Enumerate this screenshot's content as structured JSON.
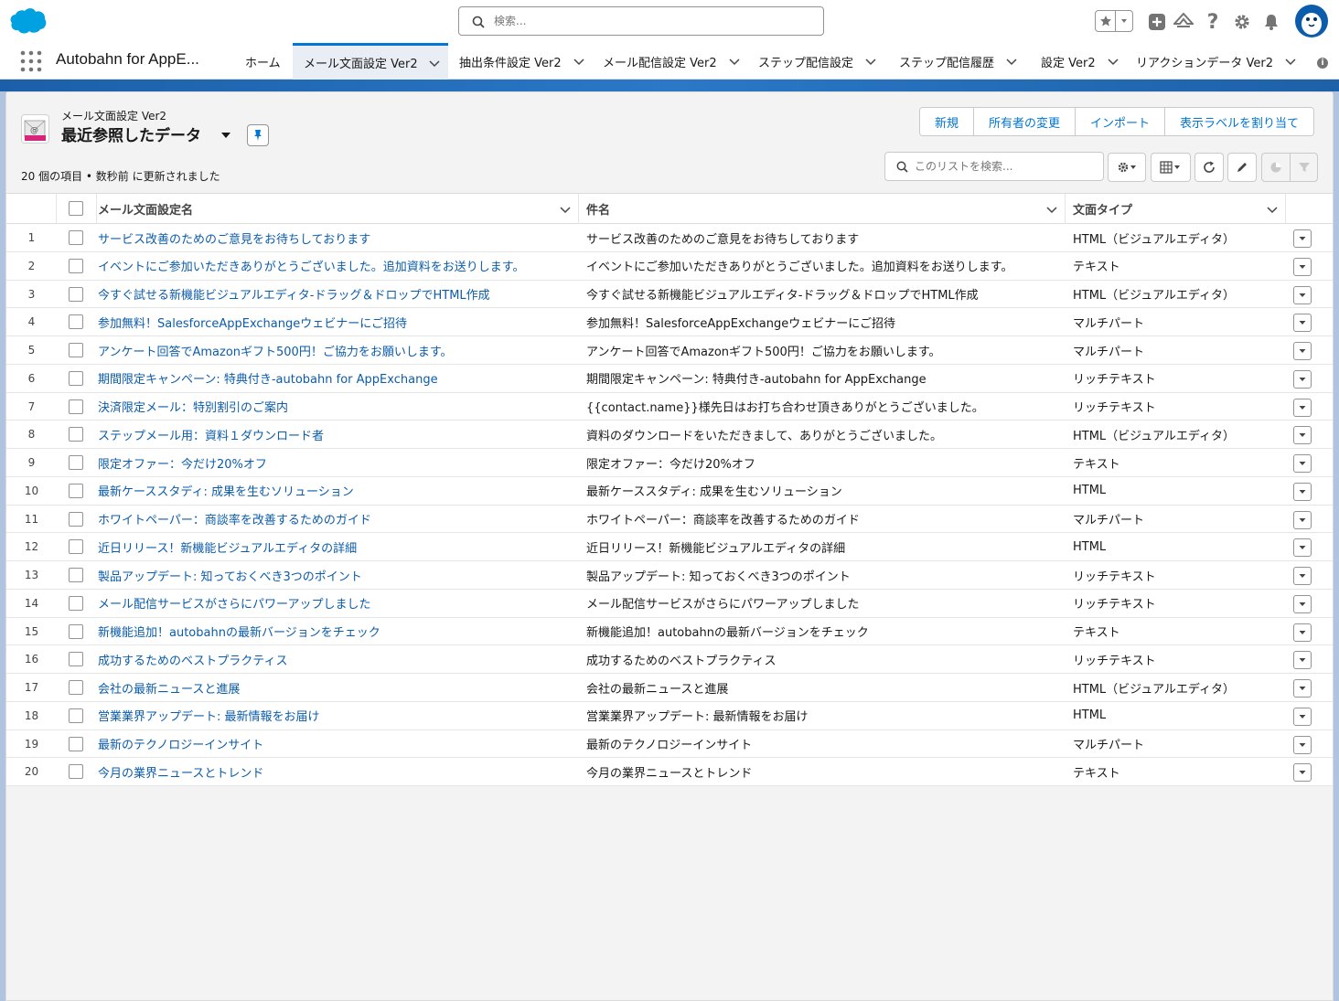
{
  "header": {
    "search_placeholder": "検索..."
  },
  "nav": {
    "app_name": "Autobahn for AppE...",
    "tabs": [
      {
        "label": "ホーム"
      },
      {
        "label": "メール文面設定 Ver2"
      },
      {
        "label": "抽出条件設定 Ver2"
      },
      {
        "label": "メール配信設定 Ver2"
      },
      {
        "label": "ステップ配信設定"
      },
      {
        "label": "ステップ配信履歴"
      },
      {
        "label": "設定 Ver2"
      },
      {
        "label": "リアクションデータ Ver2"
      }
    ]
  },
  "list_header": {
    "object_label": "メール文面設定 Ver2",
    "list_view_name": "最近参照したデータ",
    "meta": "20 個の項目 • 数秒前 に更新されました",
    "search_placeholder": "このリストを検索...",
    "buttons": {
      "new": "新規",
      "change_owner": "所有者の変更",
      "import": "インポート",
      "assign_label": "表示ラベルを割り当て"
    }
  },
  "table": {
    "columns": {
      "name": "メール文面設定名",
      "subject": "件名",
      "type": "文面タイプ"
    },
    "rows": [
      {
        "num": "1",
        "name": "サービス改善のためのご意見をお待ちしております",
        "subject": "サービス改善のためのご意見をお待ちしております",
        "type": "HTML（ビジュアルエディタ）"
      },
      {
        "num": "2",
        "name": "イベントにご参加いただきありがとうございました。追加資料をお送りします。",
        "subject": "イベントにご参加いただきありがとうございました。追加資料をお送りします。",
        "type": "テキスト"
      },
      {
        "num": "3",
        "name": "今すぐ試せる新機能ビジュアルエディタ-ドラッグ＆ドロップでHTML作成",
        "subject": "今すぐ試せる新機能ビジュアルエディタ-ドラッグ＆ドロップでHTML作成",
        "type": "HTML（ビジュアルエディタ）"
      },
      {
        "num": "4",
        "name": "参加無料！SalesforceAppExchangeウェビナーにご招待",
        "subject": "参加無料！SalesforceAppExchangeウェビナーにご招待",
        "type": "マルチパート"
      },
      {
        "num": "5",
        "name": "アンケート回答でAmazonギフト500円！ご協力をお願いします。",
        "subject": "アンケート回答でAmazonギフト500円！ご協力をお願いします。",
        "type": "マルチパート"
      },
      {
        "num": "6",
        "name": "期間限定キャンペーン: 特典付き-autobahn for AppExchange",
        "subject": "期間限定キャンペーン: 特典付き-autobahn for AppExchange",
        "type": "リッチテキスト"
      },
      {
        "num": "7",
        "name": "決済限定メール：特別割引のご案内",
        "subject": "{{contact.name}}様先日はお打ち合わせ頂きありがとうございました。",
        "type": "リッチテキスト"
      },
      {
        "num": "8",
        "name": "ステップメール用：資料１ダウンロード者",
        "subject": "資料のダウンロードをいただきまして、ありがとうございました。",
        "type": "HTML（ビジュアルエディタ）"
      },
      {
        "num": "9",
        "name": "限定オファー：今だけ20%オフ",
        "subject": "限定オファー：今だけ20%オフ",
        "type": "テキスト"
      },
      {
        "num": "10",
        "name": "最新ケーススタディ: 成果を生むソリューション",
        "subject": "最新ケーススタディ: 成果を生むソリューション",
        "type": "HTML"
      },
      {
        "num": "11",
        "name": "ホワイトペーパー：商談率を改善するためのガイド",
        "subject": "ホワイトペーパー：商談率を改善するためのガイド",
        "type": "マルチパート"
      },
      {
        "num": "12",
        "name": "近日リリース！新機能ビジュアルエディタの詳細",
        "subject": "近日リリース！新機能ビジュアルエディタの詳細",
        "type": "HTML"
      },
      {
        "num": "13",
        "name": "製品アップデート: 知っておくべき3つのポイント",
        "subject": "製品アップデート: 知っておくべき3つのポイント",
        "type": "リッチテキスト"
      },
      {
        "num": "14",
        "name": "メール配信サービスがさらにパワーアップしました",
        "subject": "メール配信サービスがさらにパワーアップしました",
        "type": "リッチテキスト"
      },
      {
        "num": "15",
        "name": "新機能追加！autobahnの最新バージョンをチェック",
        "subject": "新機能追加！autobahnの最新バージョンをチェック",
        "type": "テキスト"
      },
      {
        "num": "16",
        "name": "成功するためのベストプラクティス",
        "subject": "成功するためのベストプラクティス",
        "type": "リッチテキスト"
      },
      {
        "num": "17",
        "name": "会社の最新ニュースと進展",
        "subject": "会社の最新ニュースと進展",
        "type": "HTML（ビジュアルエディタ）"
      },
      {
        "num": "18",
        "name": "営業業界アップデート: 最新情報をお届け",
        "subject": "営業業界アップデート: 最新情報をお届け",
        "type": "HTML"
      },
      {
        "num": "19",
        "name": "最新のテクノロジーインサイト",
        "subject": "最新のテクノロジーインサイト",
        "type": "マルチパート"
      },
      {
        "num": "20",
        "name": "今月の業界ニュースとトレンド",
        "subject": "今月の業界ニュースとトレンド",
        "type": "テキスト"
      }
    ]
  },
  "colors": {
    "brand": "#0176d3",
    "link": "#0b5cab",
    "logo": "#00a1e0"
  }
}
